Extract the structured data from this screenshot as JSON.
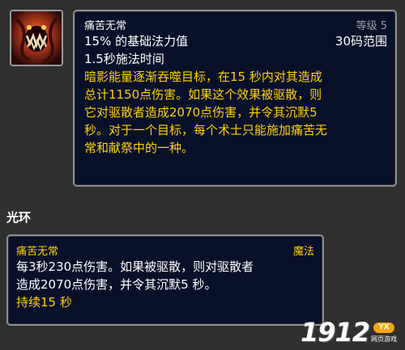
{
  "spell": {
    "icon": "shadow-pain-spell-icon",
    "name": "痛苦无常",
    "rank": "等级 5",
    "cost": "15% 的基础法力值",
    "range": "30码范围",
    "cast_time": "1.5秒施法时间",
    "description_lines": [
      "暗影能量逐渐吞噬目标，在15 秒内对其造成",
      "总计1150点伤害。如果这个效果被驱散，则",
      "它对驱散者造成2070点伤害，并令其沉默5",
      "秒。对于一个目标，每个术士只能施加痛苦无",
      "常和献祭中的一种。"
    ]
  },
  "aura_section": {
    "title": "光环",
    "name": "痛苦无常",
    "school": "魔法",
    "text_lines": [
      "每3秒230点伤害。如果被驱散，则对驱散者",
      "造成2070点伤害，并令其沉默5 秒。"
    ],
    "duration": "持续15 秒"
  },
  "watermark": {
    "number": "1912",
    "badge": "YX",
    "subtitle": "网页游戏"
  },
  "colors": {
    "tooltip_bg": "#08102a",
    "border": "#8f8f8f",
    "yellow": "#ffd100",
    "gray": "#9d9d9d",
    "page_bg": "#303030"
  }
}
